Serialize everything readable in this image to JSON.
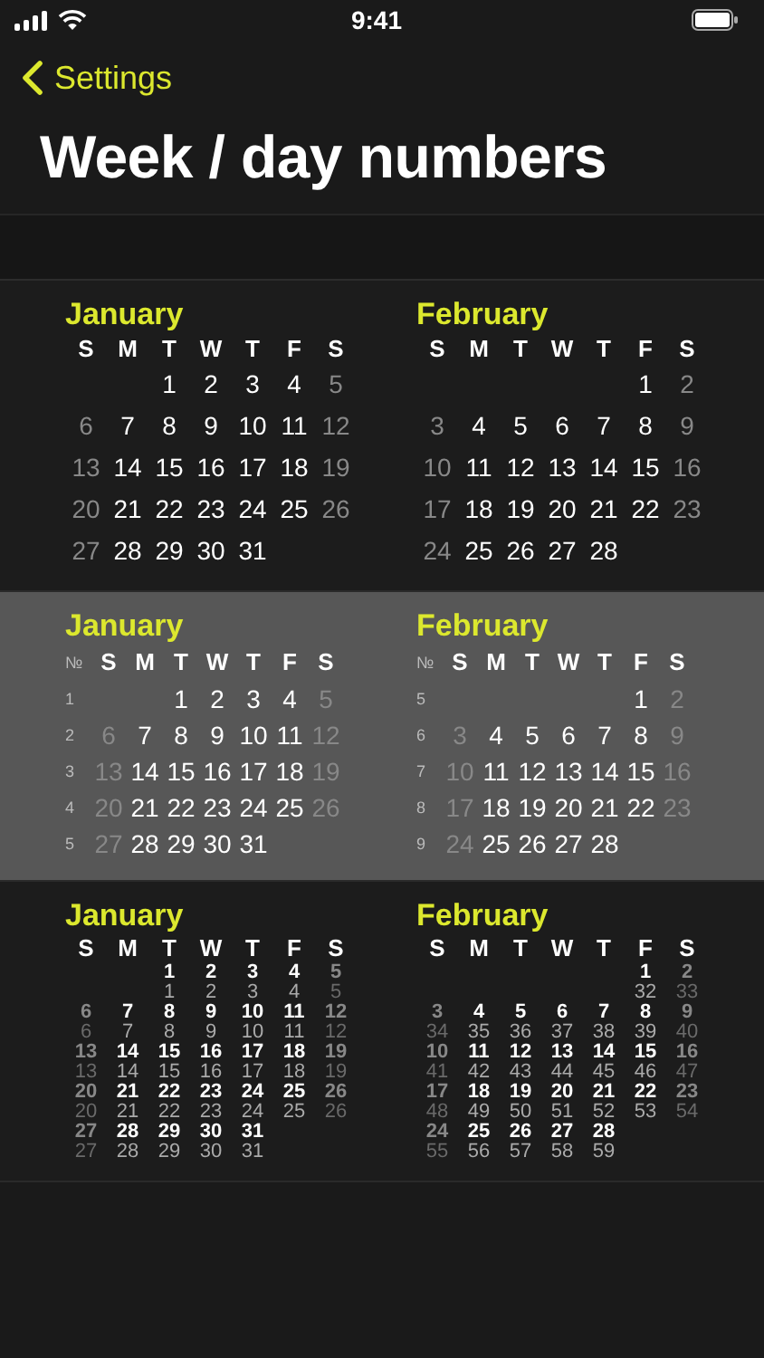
{
  "status_bar": {
    "time": "9:41"
  },
  "nav": {
    "back_label": "Settings",
    "title": "Week / day numbers"
  },
  "options": [
    {
      "kind": "plain",
      "selected": false,
      "months": [
        {
          "name": "January",
          "weekdays": [
            "S",
            "M",
            "T",
            "W",
            "T",
            "F",
            "S"
          ],
          "weeks": [
            {
              "days": [
                {
                  "day": "1",
                  "weekend": false
                },
                {
                  "day": "2",
                  "weekend": false
                },
                {
                  "day": "3",
                  "weekend": false
                },
                {
                  "day": "4",
                  "weekend": false
                },
                {
                  "day": "5",
                  "weekend": true
                }
              ]
            },
            {
              "days": [
                {
                  "day": "6",
                  "weekend": true
                },
                {
                  "day": "7",
                  "weekend": false
                },
                {
                  "day": "8",
                  "weekend": false
                },
                {
                  "day": "9",
                  "weekend": false
                },
                {
                  "day": "10",
                  "weekend": false
                },
                {
                  "day": "11",
                  "weekend": false
                },
                {
                  "day": "12",
                  "weekend": true
                }
              ]
            },
            {
              "days": [
                {
                  "day": "13",
                  "weekend": true
                },
                {
                  "day": "14",
                  "weekend": false
                },
                {
                  "day": "15",
                  "weekend": false
                },
                {
                  "day": "16",
                  "weekend": false
                },
                {
                  "day": "17",
                  "weekend": false
                },
                {
                  "day": "18",
                  "weekend": false
                },
                {
                  "day": "19",
                  "weekend": true
                }
              ]
            },
            {
              "days": [
                {
                  "day": "20",
                  "weekend": true
                },
                {
                  "day": "21",
                  "weekend": false
                },
                {
                  "day": "22",
                  "weekend": false
                },
                {
                  "day": "23",
                  "weekend": false
                },
                {
                  "day": "24",
                  "weekend": false
                },
                {
                  "day": "25",
                  "weekend": false
                },
                {
                  "day": "26",
                  "weekend": true
                }
              ]
            },
            {
              "days": [
                {
                  "day": "27",
                  "weekend": true
                },
                {
                  "day": "28",
                  "weekend": false
                },
                {
                  "day": "29",
                  "weekend": false
                },
                {
                  "day": "30",
                  "weekend": false
                },
                {
                  "day": "31",
                  "weekend": false
                }
              ]
            }
          ]
        },
        {
          "name": "February",
          "weekdays": [
            "S",
            "M",
            "T",
            "W",
            "T",
            "F",
            "S"
          ],
          "weeks": [
            {
              "days": [
                {
                  "day": "1",
                  "weekend": false
                },
                {
                  "day": "2",
                  "weekend": true
                }
              ]
            },
            {
              "days": [
                {
                  "day": "3",
                  "weekend": true
                },
                {
                  "day": "4",
                  "weekend": false
                },
                {
                  "day": "5",
                  "weekend": false
                },
                {
                  "day": "6",
                  "weekend": false
                },
                {
                  "day": "7",
                  "weekend": false
                },
                {
                  "day": "8",
                  "weekend": false
                },
                {
                  "day": "9",
                  "weekend": true
                }
              ]
            },
            {
              "days": [
                {
                  "day": "10",
                  "weekend": true
                },
                {
                  "day": "11",
                  "weekend": false
                },
                {
                  "day": "12",
                  "weekend": false
                },
                {
                  "day": "13",
                  "weekend": false
                },
                {
                  "day": "14",
                  "weekend": false
                },
                {
                  "day": "15",
                  "weekend": false
                },
                {
                  "day": "16",
                  "weekend": true
                }
              ]
            },
            {
              "days": [
                {
                  "day": "17",
                  "weekend": true
                },
                {
                  "day": "18",
                  "weekend": false
                },
                {
                  "day": "19",
                  "weekend": false
                },
                {
                  "day": "20",
                  "weekend": false
                },
                {
                  "day": "21",
                  "weekend": false
                },
                {
                  "day": "22",
                  "weekend": false
                },
                {
                  "day": "23",
                  "weekend": true
                }
              ]
            },
            {
              "days": [
                {
                  "day": "24",
                  "weekend": true
                },
                {
                  "day": "25",
                  "weekend": false
                },
                {
                  "day": "26",
                  "weekend": false
                },
                {
                  "day": "27",
                  "weekend": false
                },
                {
                  "day": "28",
                  "weekend": false
                }
              ]
            }
          ]
        }
      ]
    },
    {
      "kind": "week_numbers",
      "selected": true,
      "months": [
        {
          "name": "January",
          "number_header": "№",
          "weekdays": [
            "S",
            "M",
            "T",
            "W",
            "T",
            "F",
            "S"
          ],
          "weeks": [
            {
              "number": "1",
              "days": [
                {
                  "day": "1",
                  "weekend": false
                },
                {
                  "day": "2",
                  "weekend": false
                },
                {
                  "day": "3",
                  "weekend": false
                },
                {
                  "day": "4",
                  "weekend": false
                },
                {
                  "day": "5",
                  "weekend": true
                }
              ]
            },
            {
              "number": "2",
              "days": [
                {
                  "day": "6",
                  "weekend": true
                },
                {
                  "day": "7",
                  "weekend": false
                },
                {
                  "day": "8",
                  "weekend": false
                },
                {
                  "day": "9",
                  "weekend": false
                },
                {
                  "day": "10",
                  "weekend": false
                },
                {
                  "day": "11",
                  "weekend": false
                },
                {
                  "day": "12",
                  "weekend": true
                }
              ]
            },
            {
              "number": "3",
              "days": [
                {
                  "day": "13",
                  "weekend": true
                },
                {
                  "day": "14",
                  "weekend": false
                },
                {
                  "day": "15",
                  "weekend": false
                },
                {
                  "day": "16",
                  "weekend": false
                },
                {
                  "day": "17",
                  "weekend": false
                },
                {
                  "day": "18",
                  "weekend": false
                },
                {
                  "day": "19",
                  "weekend": true
                }
              ]
            },
            {
              "number": "4",
              "days": [
                {
                  "day": "20",
                  "weekend": true
                },
                {
                  "day": "21",
                  "weekend": false
                },
                {
                  "day": "22",
                  "weekend": false
                },
                {
                  "day": "23",
                  "weekend": false
                },
                {
                  "day": "24",
                  "weekend": false
                },
                {
                  "day": "25",
                  "weekend": false
                },
                {
                  "day": "26",
                  "weekend": true
                }
              ]
            },
            {
              "number": "5",
              "days": [
                {
                  "day": "27",
                  "weekend": true
                },
                {
                  "day": "28",
                  "weekend": false
                },
                {
                  "day": "29",
                  "weekend": false
                },
                {
                  "day": "30",
                  "weekend": false
                },
                {
                  "day": "31",
                  "weekend": false
                }
              ]
            }
          ]
        },
        {
          "name": "February",
          "number_header": "№",
          "weekdays": [
            "S",
            "M",
            "T",
            "W",
            "T",
            "F",
            "S"
          ],
          "weeks": [
            {
              "number": "5",
              "days": [
                {
                  "day": "1",
                  "weekend": false
                },
                {
                  "day": "2",
                  "weekend": true
                }
              ]
            },
            {
              "number": "6",
              "days": [
                {
                  "day": "3",
                  "weekend": true
                },
                {
                  "day": "4",
                  "weekend": false
                },
                {
                  "day": "5",
                  "weekend": false
                },
                {
                  "day": "6",
                  "weekend": false
                },
                {
                  "day": "7",
                  "weekend": false
                },
                {
                  "day": "8",
                  "weekend": false
                },
                {
                  "day": "9",
                  "weekend": true
                }
              ]
            },
            {
              "number": "7",
              "days": [
                {
                  "day": "10",
                  "weekend": true
                },
                {
                  "day": "11",
                  "weekend": false
                },
                {
                  "day": "12",
                  "weekend": false
                },
                {
                  "day": "13",
                  "weekend": false
                },
                {
                  "day": "14",
                  "weekend": false
                },
                {
                  "day": "15",
                  "weekend": false
                },
                {
                  "day": "16",
                  "weekend": true
                }
              ]
            },
            {
              "number": "8",
              "days": [
                {
                  "day": "17",
                  "weekend": true
                },
                {
                  "day": "18",
                  "weekend": false
                },
                {
                  "day": "19",
                  "weekend": false
                },
                {
                  "day": "20",
                  "weekend": false
                },
                {
                  "day": "21",
                  "weekend": false
                },
                {
                  "day": "22",
                  "weekend": false
                },
                {
                  "day": "23",
                  "weekend": true
                }
              ]
            },
            {
              "number": "9",
              "days": [
                {
                  "day": "24",
                  "weekend": true
                },
                {
                  "day": "25",
                  "weekend": false
                },
                {
                  "day": "26",
                  "weekend": false
                },
                {
                  "day": "27",
                  "weekend": false
                },
                {
                  "day": "28",
                  "weekend": false
                }
              ]
            }
          ]
        }
      ]
    },
    {
      "kind": "day_of_year",
      "selected": false,
      "months": [
        {
          "name": "January",
          "weekdays": [
            "S",
            "M",
            "T",
            "W",
            "T",
            "F",
            "S"
          ],
          "weeks": [
            {
              "days": [
                {
                  "day": "1",
                  "day_of_year": "1",
                  "weekend": false
                },
                {
                  "day": "2",
                  "day_of_year": "2",
                  "weekend": false
                },
                {
                  "day": "3",
                  "day_of_year": "3",
                  "weekend": false
                },
                {
                  "day": "4",
                  "day_of_year": "4",
                  "weekend": false
                },
                {
                  "day": "5",
                  "day_of_year": "5",
                  "weekend": true
                }
              ]
            },
            {
              "days": [
                {
                  "day": "6",
                  "day_of_year": "6",
                  "weekend": true
                },
                {
                  "day": "7",
                  "day_of_year": "7",
                  "weekend": false
                },
                {
                  "day": "8",
                  "day_of_year": "8",
                  "weekend": false
                },
                {
                  "day": "9",
                  "day_of_year": "9",
                  "weekend": false
                },
                {
                  "day": "10",
                  "day_of_year": "10",
                  "weekend": false
                },
                {
                  "day": "11",
                  "day_of_year": "11",
                  "weekend": false
                },
                {
                  "day": "12",
                  "day_of_year": "12",
                  "weekend": true
                }
              ]
            },
            {
              "days": [
                {
                  "day": "13",
                  "day_of_year": "13",
                  "weekend": true
                },
                {
                  "day": "14",
                  "day_of_year": "14",
                  "weekend": false
                },
                {
                  "day": "15",
                  "day_of_year": "15",
                  "weekend": false
                },
                {
                  "day": "16",
                  "day_of_year": "16",
                  "weekend": false
                },
                {
                  "day": "17",
                  "day_of_year": "17",
                  "weekend": false
                },
                {
                  "day": "18",
                  "day_of_year": "18",
                  "weekend": false
                },
                {
                  "day": "19",
                  "day_of_year": "19",
                  "weekend": true
                }
              ]
            },
            {
              "days": [
                {
                  "day": "20",
                  "day_of_year": "20",
                  "weekend": true
                },
                {
                  "day": "21",
                  "day_of_year": "21",
                  "weekend": false
                },
                {
                  "day": "22",
                  "day_of_year": "22",
                  "weekend": false
                },
                {
                  "day": "23",
                  "day_of_year": "23",
                  "weekend": false
                },
                {
                  "day": "24",
                  "day_of_year": "24",
                  "weekend": false
                },
                {
                  "day": "25",
                  "day_of_year": "25",
                  "weekend": false
                },
                {
                  "day": "26",
                  "day_of_year": "26",
                  "weekend": true
                }
              ]
            },
            {
              "days": [
                {
                  "day": "27",
                  "day_of_year": "27",
                  "weekend": true
                },
                {
                  "day": "28",
                  "day_of_year": "28",
                  "weekend": false
                },
                {
                  "day": "29",
                  "day_of_year": "29",
                  "weekend": false
                },
                {
                  "day": "30",
                  "day_of_year": "30",
                  "weekend": false
                },
                {
                  "day": "31",
                  "day_of_year": "31",
                  "weekend": false
                }
              ]
            }
          ]
        },
        {
          "name": "February",
          "weekdays": [
            "S",
            "M",
            "T",
            "W",
            "T",
            "F",
            "S"
          ],
          "weeks": [
            {
              "days": [
                {
                  "day": "1",
                  "day_of_year": "32",
                  "weekend": false
                },
                {
                  "day": "2",
                  "day_of_year": "33",
                  "weekend": true
                }
              ]
            },
            {
              "days": [
                {
                  "day": "3",
                  "day_of_year": "34",
                  "weekend": true
                },
                {
                  "day": "4",
                  "day_of_year": "35",
                  "weekend": false
                },
                {
                  "day": "5",
                  "day_of_year": "36",
                  "weekend": false
                },
                {
                  "day": "6",
                  "day_of_year": "37",
                  "weekend": false
                },
                {
                  "day": "7",
                  "day_of_year": "38",
                  "weekend": false
                },
                {
                  "day": "8",
                  "day_of_year": "39",
                  "weekend": false
                },
                {
                  "day": "9",
                  "day_of_year": "40",
                  "weekend": true
                }
              ]
            },
            {
              "days": [
                {
                  "day": "10",
                  "day_of_year": "41",
                  "weekend": true
                },
                {
                  "day": "11",
                  "day_of_year": "42",
                  "weekend": false
                },
                {
                  "day": "12",
                  "day_of_year": "43",
                  "weekend": false
                },
                {
                  "day": "13",
                  "day_of_year": "44",
                  "weekend": false
                },
                {
                  "day": "14",
                  "day_of_year": "45",
                  "weekend": false
                },
                {
                  "day": "15",
                  "day_of_year": "46",
                  "weekend": false
                },
                {
                  "day": "16",
                  "day_of_year": "47",
                  "weekend": true
                }
              ]
            },
            {
              "days": [
                {
                  "day": "17",
                  "day_of_year": "48",
                  "weekend": true
                },
                {
                  "day": "18",
                  "day_of_year": "49",
                  "weekend": false
                },
                {
                  "day": "19",
                  "day_of_year": "50",
                  "weekend": false
                },
                {
                  "day": "20",
                  "day_of_year": "51",
                  "weekend": false
                },
                {
                  "day": "21",
                  "day_of_year": "52",
                  "weekend": false
                },
                {
                  "day": "22",
                  "day_of_year": "53",
                  "weekend": false
                },
                {
                  "day": "23",
                  "day_of_year": "54",
                  "weekend": true
                }
              ]
            },
            {
              "days": [
                {
                  "day": "24",
                  "day_of_year": "55",
                  "weekend": true
                },
                {
                  "day": "25",
                  "day_of_year": "56",
                  "weekend": false
                },
                {
                  "day": "26",
                  "day_of_year": "57",
                  "weekend": false
                },
                {
                  "day": "27",
                  "day_of_year": "58",
                  "weekend": false
                },
                {
                  "day": "28",
                  "day_of_year": "59",
                  "weekend": false
                }
              ]
            }
          ]
        }
      ]
    }
  ]
}
